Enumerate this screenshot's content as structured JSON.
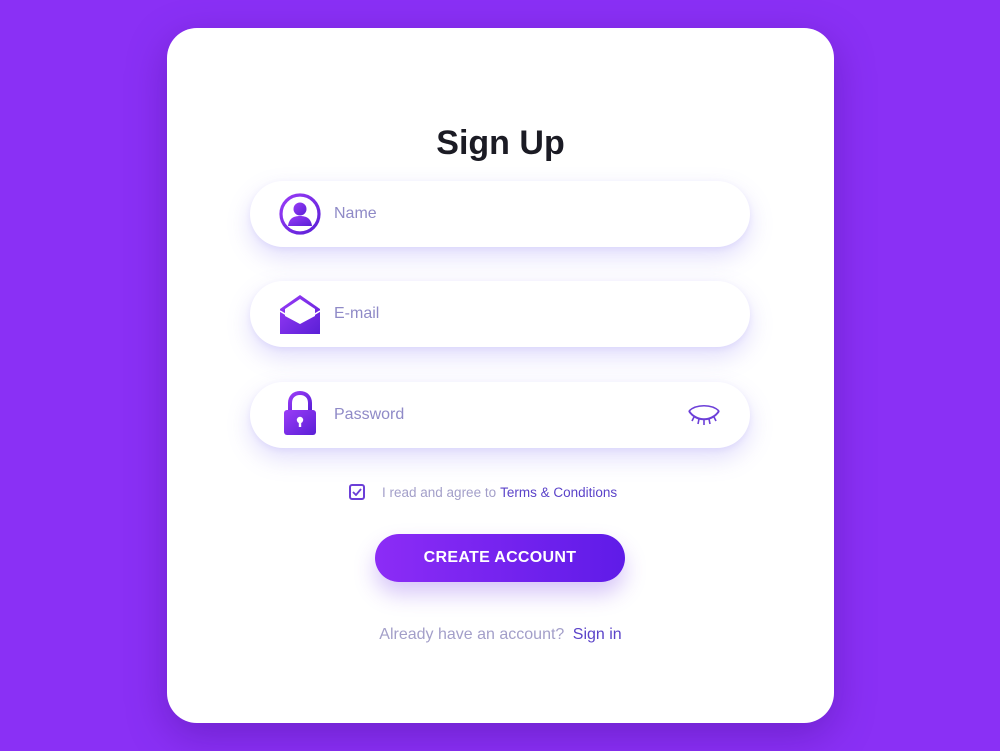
{
  "colors": {
    "background": "#8a30f5",
    "card": "#ffffff",
    "accent": "#6c2ce0",
    "button_gradient_start": "#8c2cf6",
    "button_gradient_end": "#5f1be8",
    "link": "#5b43c9",
    "muted_text": "#a39fc9"
  },
  "form": {
    "title": "Sign Up",
    "fields": {
      "name": {
        "placeholder": "Name",
        "value": "",
        "icon": "user-icon"
      },
      "email": {
        "placeholder": "E-mail",
        "value": "",
        "icon": "envelope-icon"
      },
      "password": {
        "placeholder": "Password",
        "value": "",
        "icon": "lock-icon",
        "toggle_icon": "eye-closed-icon"
      }
    },
    "agreement": {
      "checked": true,
      "text": "I read and agree to",
      "link_text": "Terms & Conditions"
    },
    "submit_label": "CREATE ACCOUNT",
    "signin": {
      "text": "Already have an account?",
      "link_text": "Sign in"
    }
  }
}
